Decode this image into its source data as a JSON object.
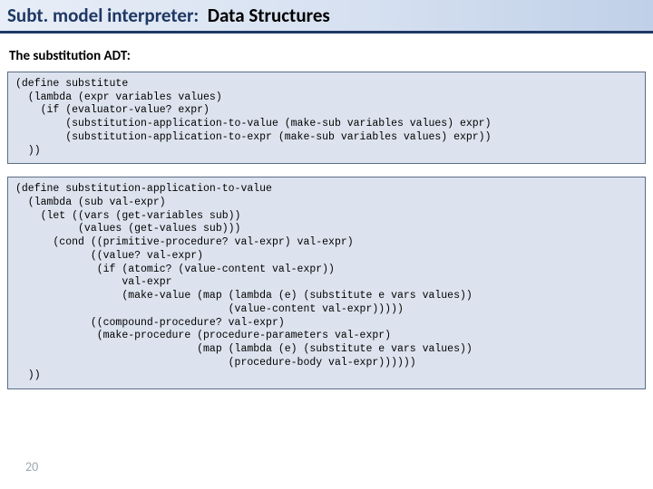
{
  "title": {
    "prefix": "Subt. model interpreter:",
    "main": "Data Structures"
  },
  "subtitle": "The substitution ADT:",
  "code1": "(define substitute\n  (lambda (expr variables values)\n    (if (evaluator-value? expr)\n        (substitution-application-to-value (make-sub variables values) expr)\n        (substitution-application-to-expr (make-sub variables values) expr))\n  ))",
  "code2": "(define substitution-application-to-value\n  (lambda (sub val-expr)\n    (let ((vars (get-variables sub))\n          (values (get-values sub)))\n      (cond ((primitive-procedure? val-expr) val-expr)\n            ((value? val-expr)\n             (if (atomic? (value-content val-expr))\n                 val-expr\n                 (make-value (map (lambda (e) (substitute e vars values))\n                                  (value-content val-expr)))))\n            ((compound-procedure? val-expr)\n             (make-procedure (procedure-parameters val-expr)\n                             (map (lambda (e) (substitute e vars values))\n                                  (procedure-body val-expr))))))\n  ))",
  "page": "20"
}
